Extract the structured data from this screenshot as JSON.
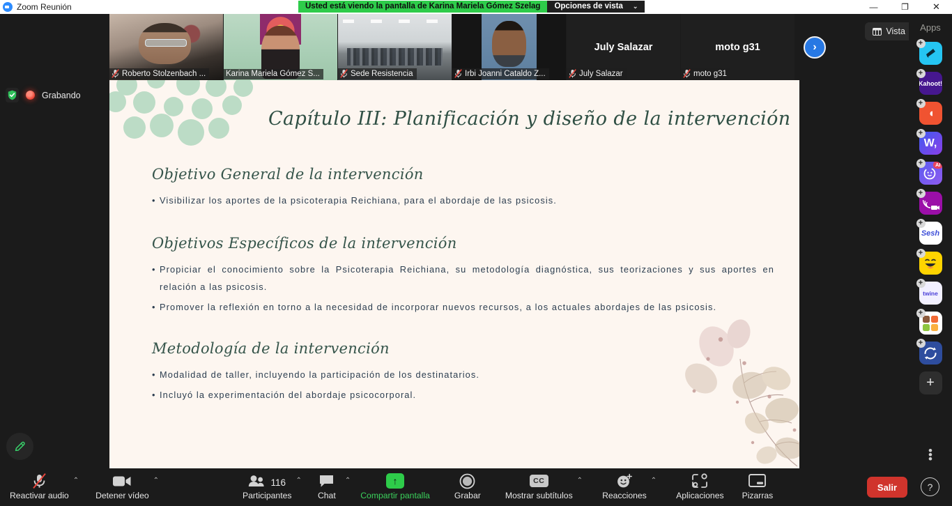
{
  "window": {
    "app_title": "Zoom Reunión",
    "logo_icon": "zoom-logo-icon",
    "minimize_icon": "minimize-icon",
    "restore_icon": "restore-icon",
    "close_icon": "close-icon",
    "minimize_glyph": "—",
    "restore_glyph": "❐",
    "close_glyph": "✕"
  },
  "share_bar": {
    "sharing_text": "Usted está viendo la pantalla de Karina Mariela Gómez Szelag",
    "view_options_label": "Opciones de vista",
    "caret_glyph": "⌄",
    "green": "#2ecc4a"
  },
  "status": {
    "shield_icon": "security-shield-icon",
    "recording_icon": "recording-dot-icon",
    "recording_label": "Grabando",
    "annotate_icon": "pen-annotate-icon"
  },
  "view_button": {
    "label": "Vista",
    "icon": "view-layout-icon"
  },
  "next_arrow": {
    "glyph": "›",
    "icon": "next-page-arrow-icon"
  },
  "filmstrip": {
    "participants": [
      {
        "name": "Roberto Stolzenbach ...",
        "video": true,
        "muted": true,
        "active": false,
        "style": "vid-roberto"
      },
      {
        "name": "Karina Mariela Gómez S...",
        "video": true,
        "muted": false,
        "active": true,
        "style": "vid-karina"
      },
      {
        "name": "Sede Resistencia",
        "video": true,
        "muted": true,
        "active": false,
        "style": "vid-sede"
      },
      {
        "name": "Irbi Joanni Cataldo Z...",
        "video": true,
        "muted": true,
        "active": false,
        "style": "vid-irbi"
      },
      {
        "name": "July Salazar",
        "video": false,
        "muted": true,
        "active": false,
        "display_name": "July Salazar"
      },
      {
        "name": "moto g31",
        "video": false,
        "muted": true,
        "active": false,
        "display_name": "moto g31"
      }
    ]
  },
  "slide": {
    "title": "Capítulo III: Planificación y diseño de la intervención",
    "bullet_glyph": "•",
    "sections": [
      {
        "heading": "Objetivo General de la intervención",
        "bullets": [
          "Visibilizar los aportes de la psicoterapia Reichiana, para el abordaje de las psicosis."
        ]
      },
      {
        "heading": "Objetivos Específicos de la intervención",
        "bullets": [
          "Propiciar el conocimiento sobre la Psicoterapia Reichiana, su metodología diagnóstica, sus teorizaciones y sus aportes en relación a las psicosis.",
          "Promover la reflexión en torno a la necesidad de incorporar nuevos recursos, a los actuales abordajes de las psicosis."
        ]
      },
      {
        "heading": "Metodología de la intervención",
        "bullets": [
          "Modalidad de taller, incluyendo la participación de los destinatarios.",
          "Incluyó la experimentación del abordaje psicocorporal."
        ]
      }
    ],
    "background_color": "#fdf6f0",
    "accent_color": "#bcdcc6",
    "heading_color": "#35544a"
  },
  "apps_panel": {
    "title": "Apps",
    "add_glyph": "+",
    "more_glyph": "⋮",
    "items": [
      {
        "name": "fun-quiz-app",
        "label": "",
        "icon": "pointer-app-icon",
        "color": "#25c5f2"
      },
      {
        "name": "kahoot-app",
        "label": "Kahoot!",
        "icon": "kahoot-app-icon",
        "color": "#46178f"
      },
      {
        "name": "puzzle-app",
        "label": "",
        "icon": "puzzle-piece-app-icon",
        "color": "#f05331"
      },
      {
        "name": "wooclap-app",
        "label": "W,",
        "icon": "wooclap-app-icon",
        "color": "#4a46e8"
      },
      {
        "name": "ai-companion-app",
        "label": "AI",
        "icon": "ai-assistant-app-icon",
        "color": "#5b5bf0"
      },
      {
        "name": "live-stream-app",
        "label": "",
        "icon": "broadcast-app-icon",
        "color": "#9b0fa8"
      },
      {
        "name": "sesh-app",
        "label": "Sesh",
        "icon": "sesh-app-icon",
        "color": "#ffffff"
      },
      {
        "name": "reactions-app",
        "label": "",
        "icon": "laughing-face-app-icon",
        "color": "#ffd400"
      },
      {
        "name": "twine-app",
        "label": "twine",
        "icon": "twine-app-icon",
        "color": "#f2f0ff"
      },
      {
        "name": "mural-app",
        "label": "",
        "icon": "color-blocks-app-icon",
        "color": "#ffffff"
      },
      {
        "name": "sync-app",
        "label": "",
        "icon": "sync-arrows-app-icon",
        "color": "#2e4d9e"
      }
    ]
  },
  "toolbar": {
    "items": [
      {
        "id": "audio",
        "label": "Reactivar audio",
        "icon": "microphone-muted-icon",
        "caret": true,
        "active": false
      },
      {
        "id": "video",
        "label": "Detener vídeo",
        "icon": "camera-icon",
        "caret": true,
        "active": false
      },
      {
        "id": "participants",
        "label": "Participantes",
        "icon": "participants-icon",
        "caret": true,
        "count": "116",
        "active": false
      },
      {
        "id": "chat",
        "label": "Chat",
        "icon": "chat-bubble-icon",
        "caret": true,
        "active": false
      },
      {
        "id": "share",
        "label": "Compartir pantalla",
        "icon": "share-screen-icon",
        "caret": false,
        "active": true
      },
      {
        "id": "record",
        "label": "Grabar",
        "icon": "record-circle-icon",
        "caret": false,
        "active": false
      },
      {
        "id": "captions",
        "label": "Mostrar subtítulos",
        "icon": "closed-captions-icon",
        "caret": true,
        "active": false
      },
      {
        "id": "reactions",
        "label": "Reacciones",
        "icon": "reactions-smiley-icon",
        "caret": true,
        "active": false
      },
      {
        "id": "apps",
        "label": "Aplicaciones",
        "icon": "apps-grid-icon",
        "caret": false,
        "active": false
      },
      {
        "id": "whiteboards",
        "label": "Pizarras",
        "icon": "whiteboard-icon",
        "caret": false,
        "active": false
      }
    ],
    "leave_label": "Salir",
    "leave_color": "#d0342c",
    "help_glyph": "?",
    "help_icon": "help-question-icon",
    "caret_glyph": "⌃"
  }
}
